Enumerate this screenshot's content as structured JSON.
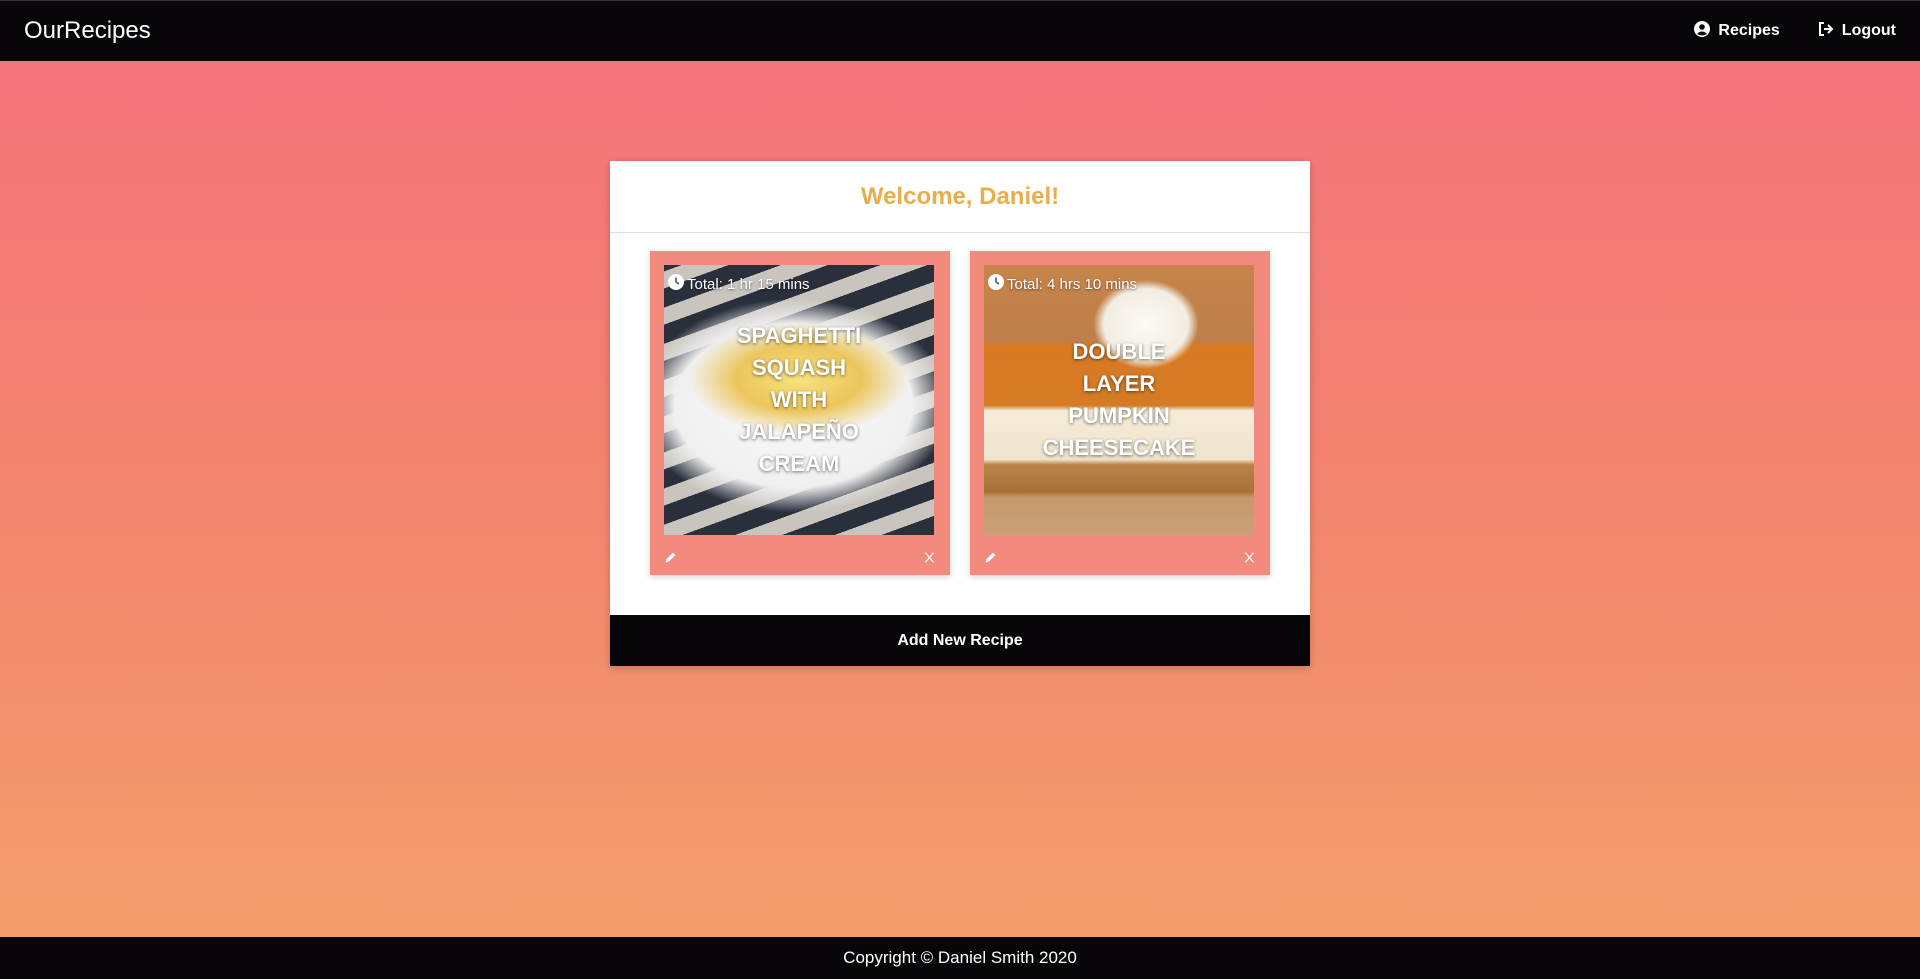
{
  "nav": {
    "brand": "OurRecipes",
    "links": [
      {
        "label": "Recipes",
        "icon": "user-circle-icon"
      },
      {
        "label": "Logout",
        "icon": "sign-out-icon"
      }
    ]
  },
  "card": {
    "welcome": "Welcome, Daniel!",
    "recipes": [
      {
        "time": "Total: 1 hr 15 mins",
        "title": "Spaghetti Squash with Jalapeño Cream"
      },
      {
        "time": "Total: 4 hrs 10 mins",
        "title": "Double Layer Pumpkin Cheesecake"
      }
    ],
    "add_label": "Add New Recipe"
  },
  "footer": {
    "text": "Copyright © Daniel Smith 2020"
  },
  "colors": {
    "accent": "#e9ad4b",
    "dark": "#080608",
    "recipe_bg": "#f28a7e"
  }
}
